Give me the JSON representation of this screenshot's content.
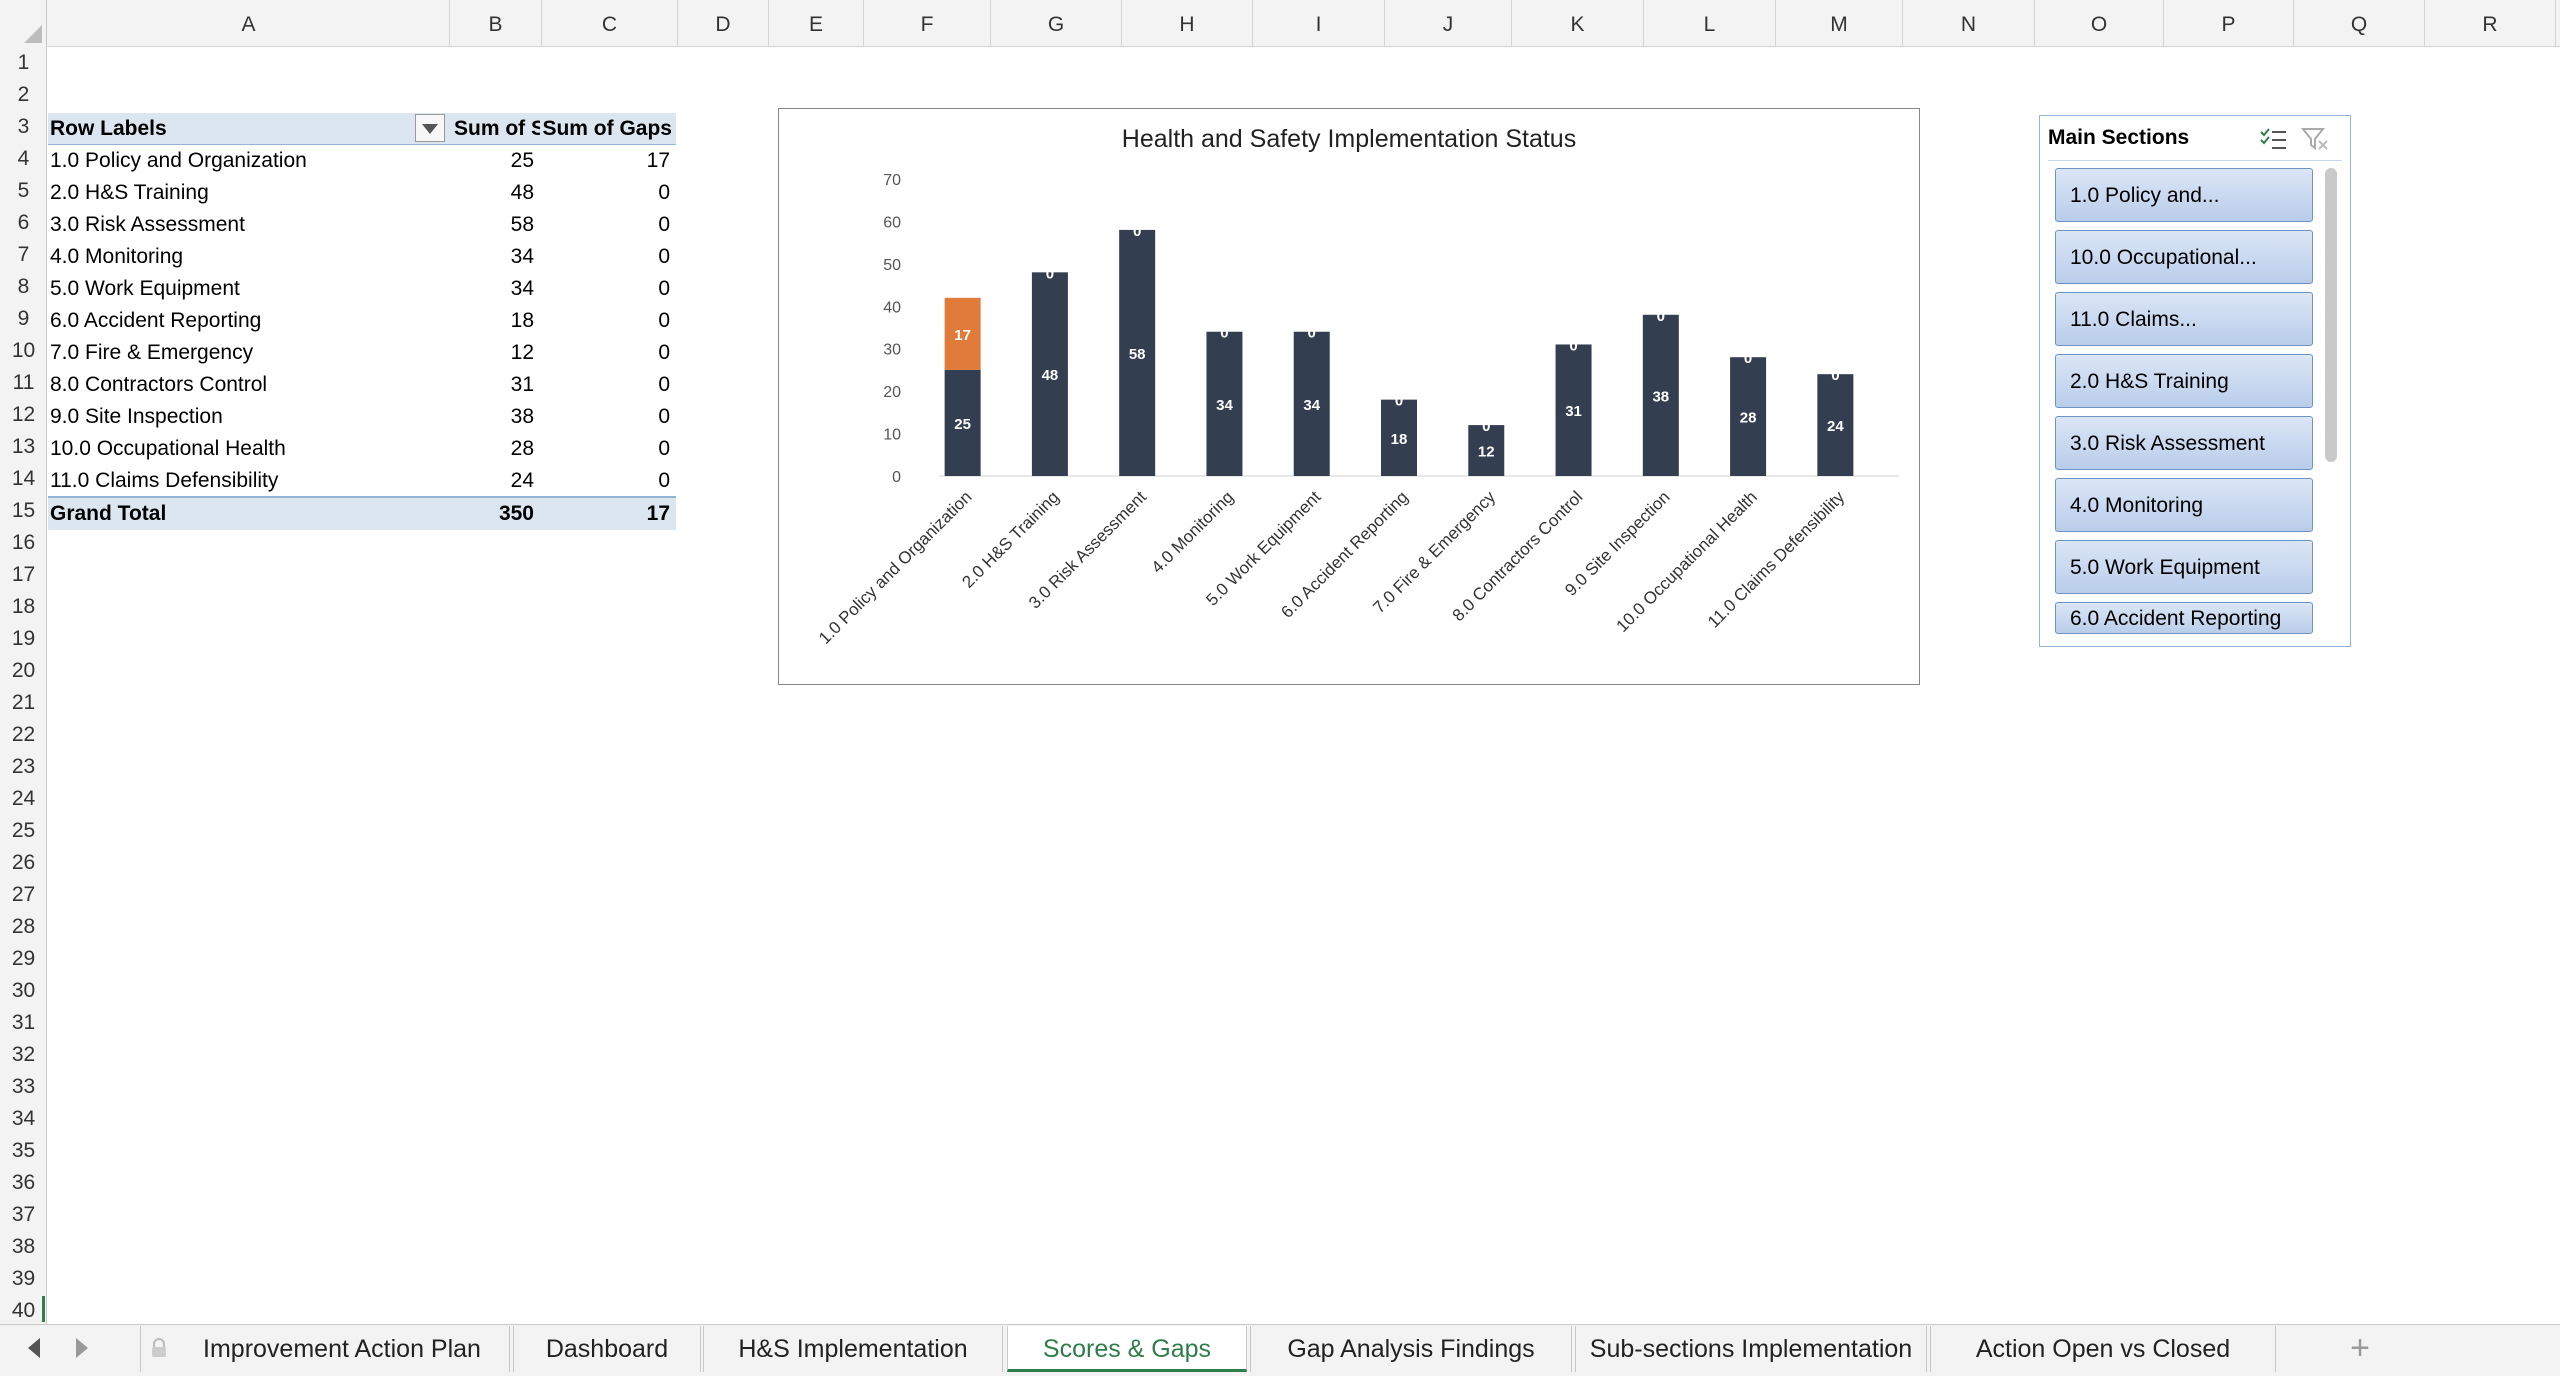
{
  "columns": [
    "A",
    "B",
    "C",
    "D",
    "E",
    "F",
    "G",
    "H",
    "I",
    "J",
    "K",
    "L",
    "M",
    "N",
    "O",
    "P",
    "Q",
    "R"
  ],
  "rows": [
    "1",
    "2",
    "3",
    "4",
    "5",
    "6",
    "7",
    "8",
    "9",
    "10",
    "11",
    "12",
    "13",
    "14",
    "15",
    "16",
    "17",
    "18",
    "19",
    "20",
    "21",
    "22",
    "23",
    "24",
    "25",
    "26",
    "27",
    "28",
    "29",
    "30",
    "31",
    "32",
    "33",
    "34",
    "35",
    "36",
    "37",
    "38",
    "39",
    "40"
  ],
  "pivot": {
    "header": {
      "row_labels": "Row Labels",
      "sum_scores": "Sum of S",
      "sum_gaps": "Sum of Gaps"
    },
    "rows": [
      {
        "label": "1.0 Policy and Organization",
        "score": "25",
        "gaps": "17"
      },
      {
        "label": "2.0 H&S Training",
        "score": "48",
        "gaps": "0"
      },
      {
        "label": "3.0 Risk Assessment",
        "score": "58",
        "gaps": "0"
      },
      {
        "label": "4.0 Monitoring",
        "score": "34",
        "gaps": "0"
      },
      {
        "label": "5.0 Work Equipment",
        "score": "34",
        "gaps": "0"
      },
      {
        "label": "6.0 Accident Reporting",
        "score": "18",
        "gaps": "0"
      },
      {
        "label": "7.0 Fire & Emergency",
        "score": "12",
        "gaps": "0"
      },
      {
        "label": "8.0 Contractors Control",
        "score": "31",
        "gaps": "0"
      },
      {
        "label": "9.0 Site Inspection",
        "score": "38",
        "gaps": "0"
      },
      {
        "label": "10.0 Occupational Health",
        "score": "28",
        "gaps": "0"
      },
      {
        "label": "11.0 Claims Defensibility",
        "score": "24",
        "gaps": "0"
      }
    ],
    "total": {
      "label": "Grand Total",
      "score": "350",
      "gaps": "17"
    }
  },
  "chart_data": {
    "type": "bar",
    "stacked": true,
    "title": "Health and Safety Implementation Status",
    "categories": [
      "1.0 Policy and Organization",
      "2.0 H&S Training",
      "3.0 Risk Assessment",
      "4.0 Monitoring",
      "5.0 Work Equipment",
      "6.0 Accident Reporting",
      "7.0 Fire & Emergency",
      "8.0 Contractors Control",
      "9.0 Site Inspection",
      "10.0 Occupational Health",
      "11.0 Claims Defensibility"
    ],
    "series": [
      {
        "values": [
          25,
          48,
          58,
          34,
          34,
          18,
          12,
          31,
          38,
          28,
          24
        ],
        "color": "#333f50"
      },
      {
        "values": [
          17,
          0,
          0,
          0,
          0,
          0,
          0,
          0,
          0,
          0,
          0
        ],
        "color": "#e07b39"
      }
    ],
    "ylim": [
      0,
      70
    ],
    "yticks": [
      0,
      10,
      20,
      30,
      40,
      50,
      60,
      70
    ],
    "xlabel": "",
    "ylabel": "",
    "legend": "none",
    "grid": false
  },
  "slicer": {
    "title": "Main Sections",
    "items": [
      "1.0 Policy and...",
      "10.0 Occupational...",
      "11.0 Claims...",
      "2.0 H&S Training",
      "3.0 Risk Assessment",
      "4.0 Monitoring",
      "5.0 Work Equipment",
      "6.0 Accident Reporting"
    ]
  },
  "tabs": [
    {
      "label": "Improvement Action Plan",
      "active": false
    },
    {
      "label": "Dashboard",
      "active": false
    },
    {
      "label": "H&S Implementation",
      "active": false
    },
    {
      "label": "Scores & Gaps",
      "active": true
    },
    {
      "label": "Gap Analysis Findings",
      "active": false
    },
    {
      "label": "Sub-sections Implementation",
      "active": false
    },
    {
      "label": "Action Open vs Closed",
      "active": false
    }
  ],
  "add_sheet": "+"
}
